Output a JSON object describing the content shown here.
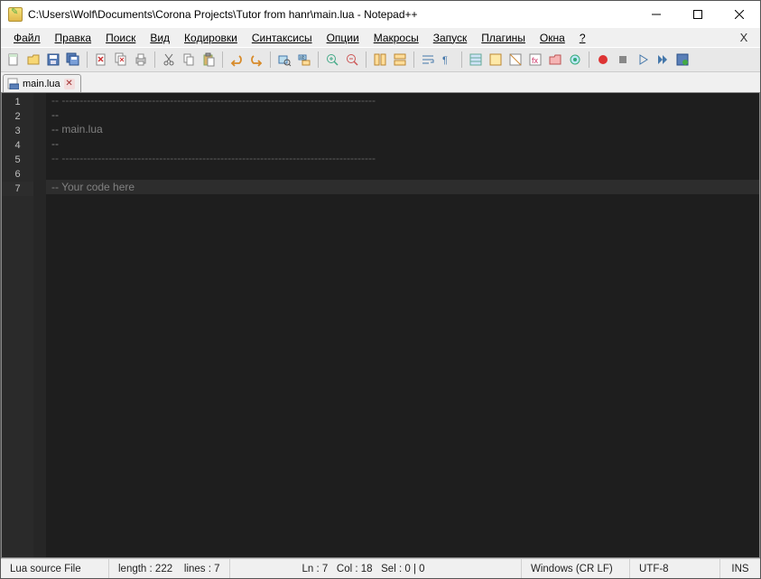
{
  "title": "C:\\Users\\Wolf\\Documents\\Corona Projects\\Tutor from hanr\\main.lua - Notepad++",
  "menu": {
    "file": "Файл",
    "edit": "Правка",
    "search": "Поиск",
    "view": "Вид",
    "encoding": "Кодировки",
    "syntax": "Синтаксисы",
    "options": "Опции",
    "macros": "Макросы",
    "run": "Запуск",
    "plugins": "Плагины",
    "windows": "Окна",
    "help": "?"
  },
  "tab": {
    "name": "main.lua"
  },
  "code": {
    "dash_long": "-- ---------------------------------------------------------------------------------------",
    "dash_short": "--",
    "l3": "-- main.lua",
    "l7": "-- Your code here"
  },
  "gutter": {
    "lines": [
      "1",
      "2",
      "3",
      "4",
      "5",
      "6",
      "7"
    ]
  },
  "status": {
    "filetype": "Lua source File",
    "length": "length : 222",
    "lines": "lines : 7",
    "ln": "Ln : 7",
    "col": "Col : 18",
    "sel": "Sel : 0 | 0",
    "eol": "Windows (CR LF)",
    "enc": "UTF-8",
    "mode": "INS"
  }
}
